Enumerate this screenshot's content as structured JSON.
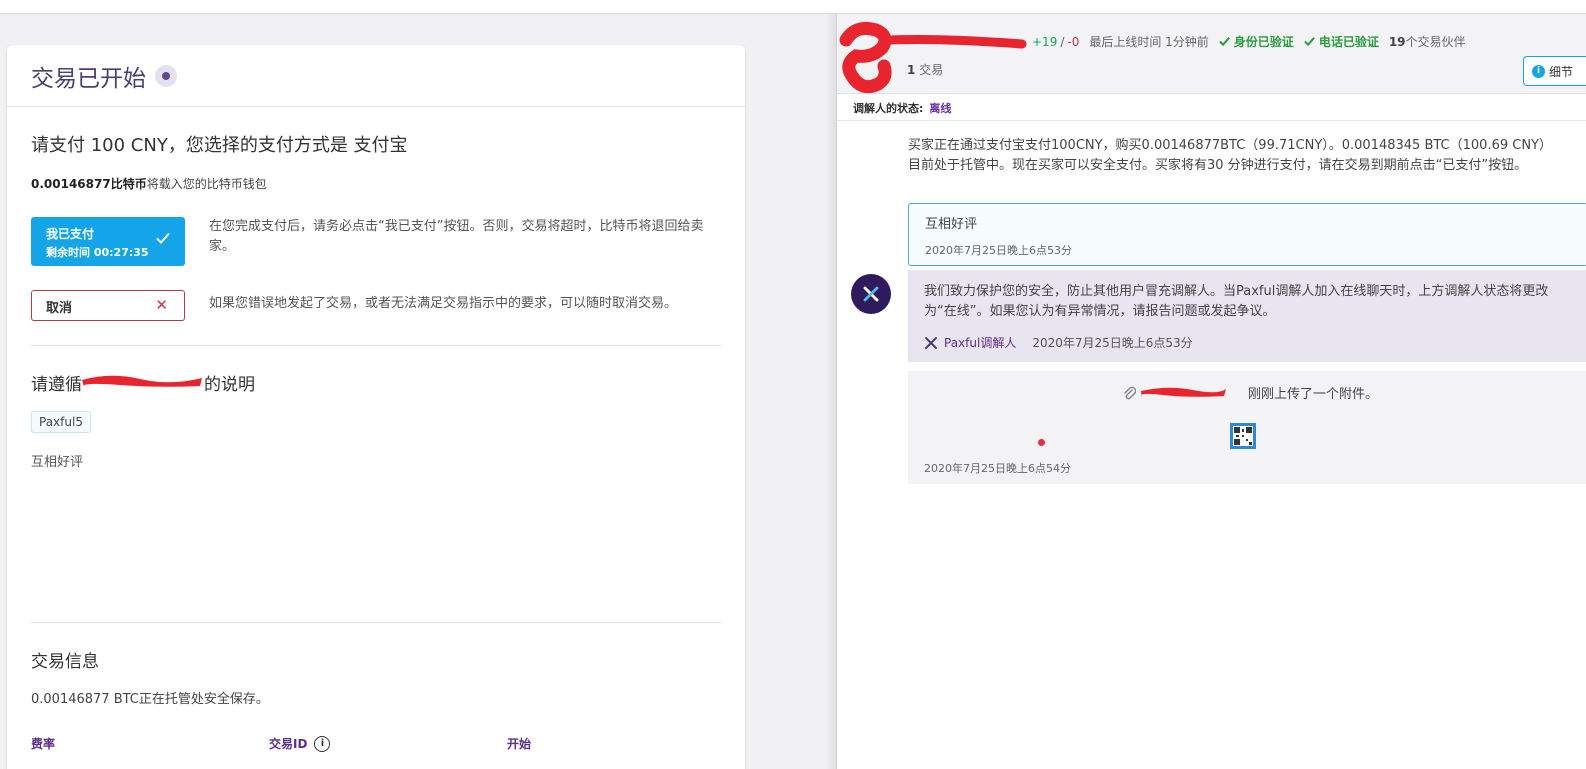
{
  "trade": {
    "title": "交易已开始",
    "pay_title": "请支付 100 CNY，您选择的支付方式是 支付宝",
    "amount_bold": "0.00146877比特币",
    "amount_rest": "将载入您的比特币钱包",
    "paid_button": {
      "label": "我已支付",
      "remaining": "剩余时间 00:27:35"
    },
    "paid_desc": "在您完成支付后，请务必点击“我已支付”按钮。否则，交易将超时，比特币将退回给卖家。",
    "cancel_button": "取消",
    "cancel_desc": "如果您错误地发起了交易，或者无法满足交易指示中的要求，可以随时取消交易。",
    "follow_prefix": "请遵循",
    "follow_suffix": "的说明",
    "tag": "Paxful5",
    "note": "互相好评",
    "info_title": "交易信息",
    "escrow_text": "0.00146877 BTC正在托管处安全保存。",
    "columns": [
      "费率",
      "交易ID",
      "开始"
    ]
  },
  "chat": {
    "stats": {
      "positive": "+19",
      "sep": "/",
      "negative": "-0",
      "last_online": "最后上线时间 1分钟前",
      "id_verified": "身份已验证",
      "phone_verified": "电话已验证",
      "partners_count": "19",
      "partners_label": "个交易伙伴"
    },
    "trades_count": "1",
    "trades_label": "交易",
    "details_button": "细节",
    "mediator_label": "调解人的状态:",
    "mediator_status": "离线",
    "system_message": "买家正在通过支付宝支付100CNY，购买0.00146877BTC（99.71CNY）。0.00148345 BTC（100.69 CNY）目前处于托管中。现在买家可以安全支付。买家将有30 分钟进行支付，请在交易到期前点击“已支付”按钮。",
    "review": {
      "text": "互相好评",
      "date": "2020年7月25日晚上6点53分"
    },
    "safety": {
      "text": "我们致力保护您的安全，防止其他用户冒充调解人。当Paxful调解人加入在线聊天时，上方调解人状态将更改为“在线”。如果您认为有异常情况，请报告问题或发起争议。",
      "author": "Paxful调解人",
      "date": "2020年7月25日晚上6点53分"
    },
    "attachment": {
      "text": "刚刚上传了一个附件。",
      "date": "2020年7月25日晚上6点54分"
    }
  },
  "colors": {
    "primary_blue": "#14a4e8",
    "brand_purple": "#5b2f8a",
    "cancel_red": "#b03a4c",
    "verified_green": "#2a9b3e"
  }
}
